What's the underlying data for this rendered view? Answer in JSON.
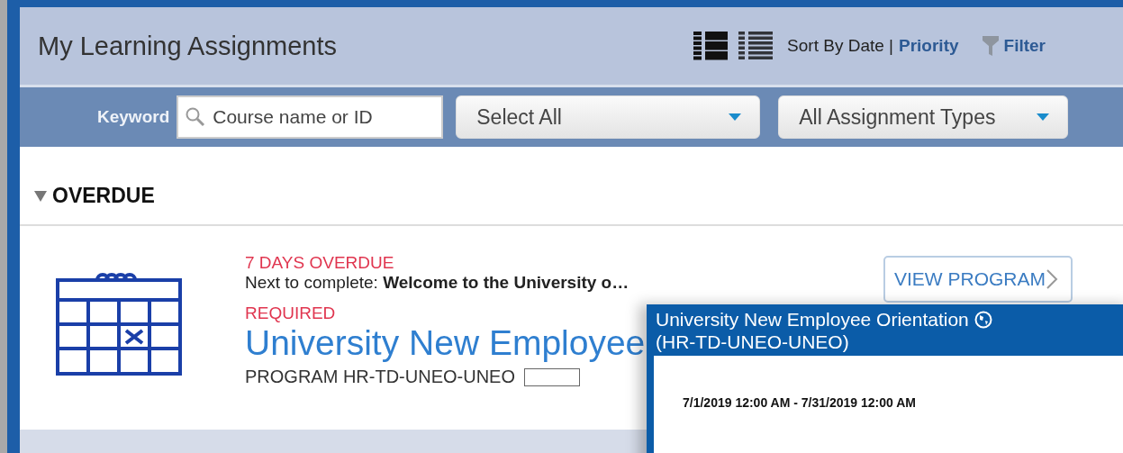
{
  "header": {
    "title": "My Learning Assignments",
    "views": [
      {
        "kind": "detailed",
        "selected": true
      },
      {
        "kind": "compact",
        "selected": false
      }
    ],
    "sort_label": "Sort By Date",
    "sort_separator": "|",
    "sort_options": [
      {
        "label": "Priority",
        "selected": false
      }
    ],
    "filter": "Filter"
  },
  "filters": {
    "keyword_label": "Keyword",
    "search": {
      "placeholder": "Course name or ID"
    },
    "dropdowns": [
      {
        "value": "Select All"
      },
      {
        "value": "All Assignment Types"
      }
    ]
  },
  "section": {
    "title": "OVERDUE",
    "expanded": true
  },
  "assignment": {
    "status": "7 DAYS OVERDUE",
    "next_label": "Next to complete:",
    "next_value": "Welcome to the University o…",
    "required": "REQUIRED",
    "title": "University New Employee",
    "code": "PROGRAM HR-TD-UNEO-UNEO",
    "action": "VIEW PROGRAM"
  },
  "popup": {
    "title": "University New Employee Orientation",
    "subtitle": "(HR-TD-UNEO-UNEO)",
    "dates": "7/1/2019 12:00 AM - 7/31/2019 12:00 AM"
  }
}
